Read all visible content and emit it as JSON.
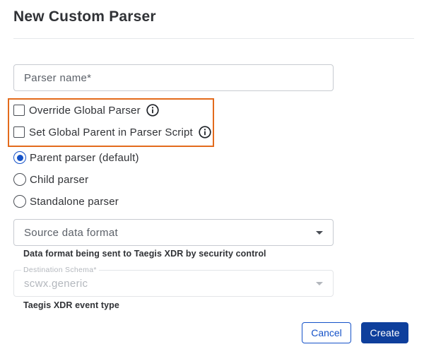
{
  "dialog": {
    "title": "New Custom Parser"
  },
  "parser_name": {
    "placeholder": "Parser name*",
    "value": ""
  },
  "checkboxes": [
    {
      "label": "Override Global Parser",
      "checked": false
    },
    {
      "label": "Set Global Parent in Parser Script",
      "checked": false
    }
  ],
  "parser_type": {
    "options": [
      {
        "label": "Parent parser (default)",
        "selected": true
      },
      {
        "label": "Child parser",
        "selected": false
      },
      {
        "label": "Standalone parser",
        "selected": false
      }
    ]
  },
  "source_format": {
    "placeholder": "Source data format",
    "helper": "Data format being sent to Taegis XDR by security control"
  },
  "destination_schema": {
    "label": "Destination Schema*",
    "value": "scwx.generic",
    "helper": "Taegis XDR event type",
    "disabled": true
  },
  "actions": {
    "cancel_label": "Cancel",
    "create_label": "Create"
  },
  "colors": {
    "accent": "#1552c8",
    "primary_button": "#0e3f9c",
    "highlight": "#e36b1c"
  },
  "icons": {
    "info": "info-icon",
    "dropdown": "chevron-down-icon"
  }
}
